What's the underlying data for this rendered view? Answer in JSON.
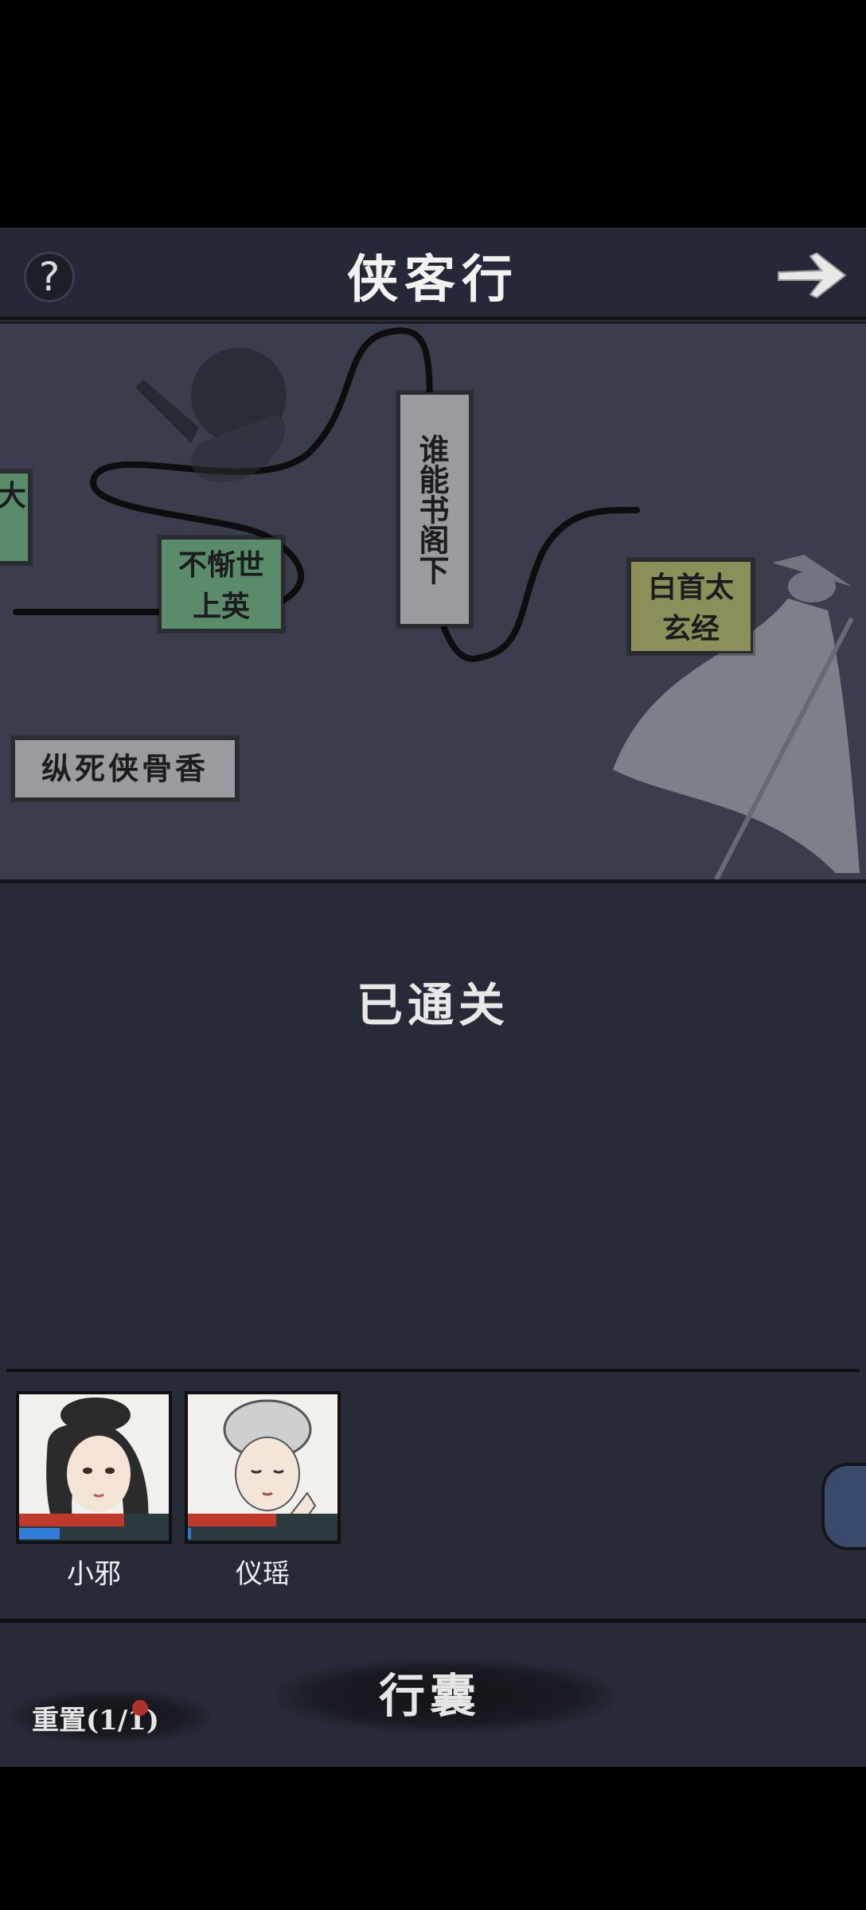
{
  "header": {
    "title": "侠客行",
    "help_icon": "question-icon",
    "next_icon": "arrow-right-icon"
  },
  "map": {
    "nodes": [
      {
        "id": "n1",
        "label": "纵死侠骨香",
        "color": "grey"
      },
      {
        "id": "n2",
        "label": "不惭世上英",
        "color": "green"
      },
      {
        "id": "n3",
        "label": "谁能书阁下",
        "color": "grey"
      },
      {
        "id": "n4",
        "label": "白首太玄经",
        "color": "olive"
      },
      {
        "id": "n0",
        "label": "大",
        "color": "green"
      }
    ]
  },
  "status": {
    "text": "已通关"
  },
  "party": [
    {
      "name": "小邪",
      "hp": 0.7,
      "mp": 0.27
    },
    {
      "name": "仪瑶",
      "hp": 0.59,
      "mp": 0.02
    }
  ],
  "footer": {
    "bag_label": "行囊",
    "reset_label": "重置(1/1)"
  }
}
